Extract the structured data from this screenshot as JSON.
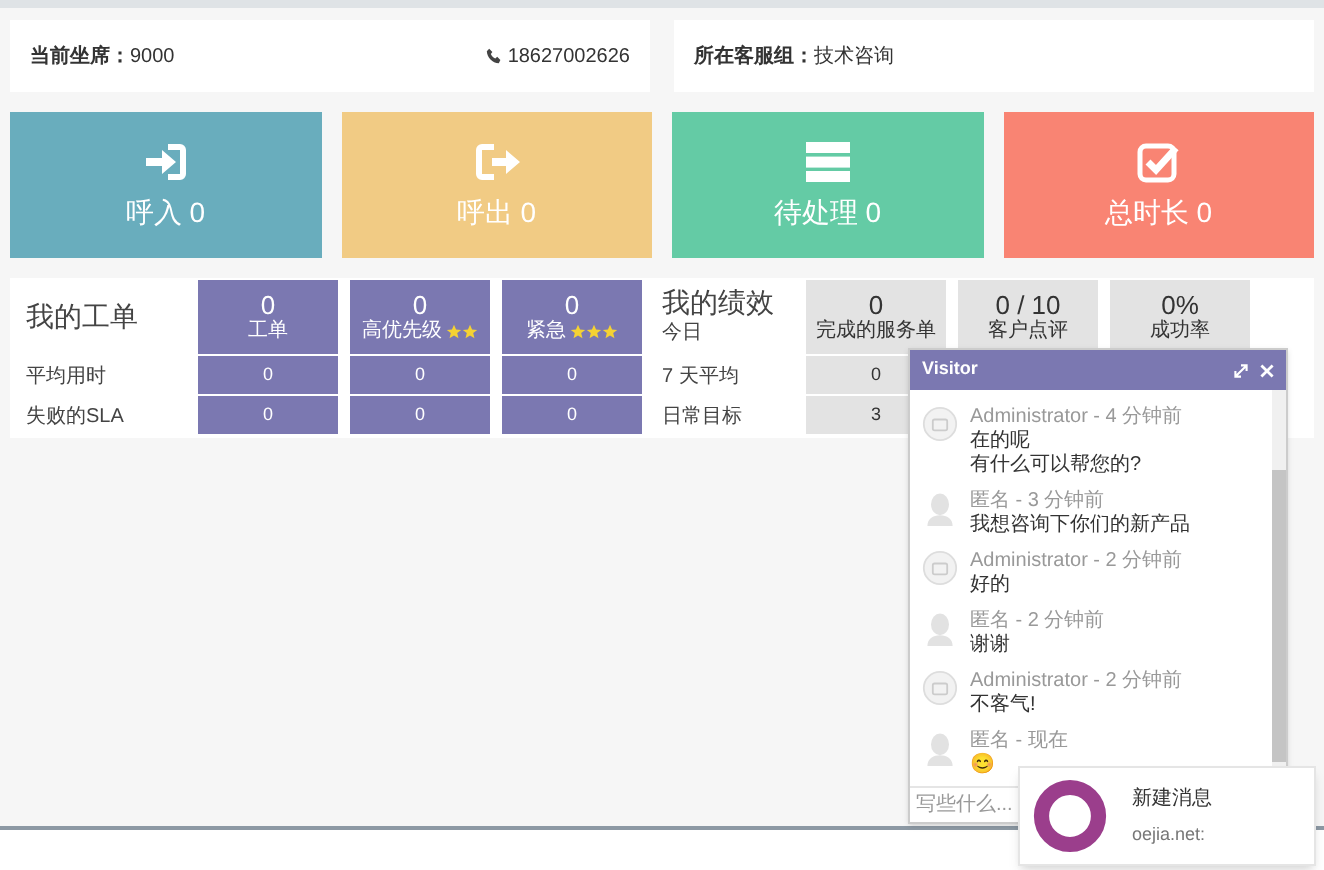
{
  "info_bar": {
    "seat_label": "当前坐席：",
    "seat": "9000",
    "phone": "18627002626",
    "group_label": "所在客服组：",
    "group": "技术咨询"
  },
  "tiles": [
    {
      "kind": "in",
      "label": "呼入 0",
      "color": "#69adbd"
    },
    {
      "kind": "out",
      "label": "呼出 0",
      "color": "#f1cb84"
    },
    {
      "kind": "pending",
      "label": "待处理 0",
      "color": "#64cba5"
    },
    {
      "kind": "total",
      "label": "总时长 0",
      "color": "#f98473"
    }
  ],
  "tickets": {
    "title": "我的工单",
    "columns": [
      {
        "value": "0",
        "label": "工单"
      },
      {
        "value": "0",
        "label": "高优先级",
        "stars": 2
      },
      {
        "value": "0",
        "label": "紧急",
        "stars": 3
      }
    ],
    "rows": [
      {
        "label": "平均用时",
        "values": [
          "0",
          "0",
          "0"
        ]
      },
      {
        "label": "失败的SLA",
        "values": [
          "0",
          "0",
          "0"
        ]
      }
    ]
  },
  "performance": {
    "title": "我的绩效",
    "subtitle": "今日",
    "columns": [
      {
        "value": "0",
        "label": "完成的服务单"
      },
      {
        "value": "0 / 10",
        "label": "客户点评"
      },
      {
        "value": "0%",
        "label": "成功率"
      }
    ],
    "rows": [
      {
        "label": "7 天平均",
        "values": [
          "0"
        ]
      },
      {
        "label": "日常目标",
        "values": [
          "3"
        ]
      }
    ]
  },
  "chat": {
    "title": "Visitor",
    "messages": [
      {
        "kind": "admin",
        "author": "Administrator",
        "separator": "-",
        "time": "4 分钟前",
        "lines": [
          "在的呢",
          "有什么可以帮您的?"
        ]
      },
      {
        "kind": "visitor",
        "author": "匿名",
        "separator": "-",
        "time": "3 分钟前",
        "lines": [
          "我想咨询下你们的新产品"
        ]
      },
      {
        "kind": "admin",
        "author": "Administrator",
        "separator": "-",
        "time": "2 分钟前",
        "lines": [
          "好的"
        ]
      },
      {
        "kind": "visitor",
        "author": "匿名",
        "separator": "-",
        "time": "2 分钟前",
        "lines": [
          "谢谢"
        ]
      },
      {
        "kind": "admin",
        "author": "Administrator",
        "separator": "-",
        "time": "2 分钟前",
        "lines": [
          "不客气!"
        ]
      },
      {
        "kind": "visitor",
        "author": "匿名",
        "separator": "-",
        "time": "现在",
        "lines": [
          "😊"
        ]
      }
    ],
    "placeholder": "写些什么..."
  },
  "notification": {
    "title": "新建消息",
    "source": "oejia.net:"
  }
}
